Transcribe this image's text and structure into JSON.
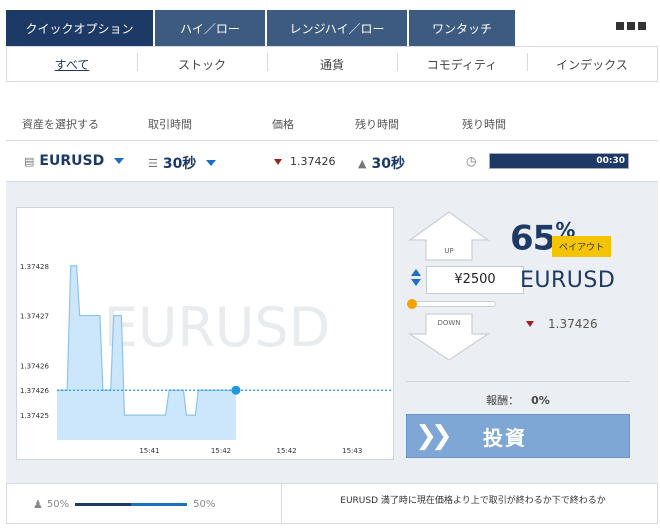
{
  "tabs": [
    {
      "label": "クイックオプション",
      "active": true
    },
    {
      "label": "ハイ／ロー",
      "active": false
    },
    {
      "label": "レンジハイ／ロー",
      "active": false
    },
    {
      "label": "ワンタッチ",
      "active": false
    }
  ],
  "categories": [
    "すべて",
    "ストック",
    "通貨",
    "コモディティ",
    "インデックス"
  ],
  "headers": {
    "asset": "資産を選択する",
    "period": "取引時間",
    "price": "価格",
    "remaining": "残り時間",
    "remaining2": "残り時間"
  },
  "selection": {
    "asset": "EURUSD",
    "period": "30秒",
    "price": "1.37426",
    "remaining": "30秒",
    "timer": "00:30"
  },
  "trade": {
    "up_label": "UP",
    "down_label": "DOWN",
    "amount": "¥2500",
    "payout_percent": "65",
    "payout_percent_sign": "%",
    "payout_badge": "ペイアウト",
    "asset": "EURUSD",
    "price": "1.37426",
    "reward_label": "報酬：",
    "reward_value": "0%",
    "invest_label": "投資"
  },
  "sentiment": {
    "left": "50%",
    "right": "50%",
    "left_fraction": 0.5
  },
  "hint": "EURUSD 満了時に現在価格より上で取引が終わるか下で終わるか",
  "colors": {
    "navy": "#1d3a66",
    "accent": "#1d6fc0",
    "area": "#cce6fb",
    "badge": "#f5c400"
  },
  "chart_data": {
    "type": "area",
    "watermark": "EURUSD",
    "y_ticks": [
      "1.37428",
      "1.37427",
      "1.37426",
      "1.37426",
      "1.37425"
    ],
    "y_tick_values": [
      1.37428,
      1.37427,
      1.37426,
      1.374255,
      1.37425
    ],
    "x_ticks": [
      "15:41",
      "15:42",
      "15:42",
      "15:43"
    ],
    "x_tick_values": [
      15.5,
      27.5,
      38.5,
      49.5
    ],
    "ylim": [
      1.374245,
      1.37429
    ],
    "xlim": [
      0,
      56
    ],
    "strike": 1.374255,
    "points": [
      [
        0,
        1.374255
      ],
      [
        1.7,
        1.374255
      ],
      [
        2.3,
        1.37428
      ],
      [
        3.3,
        1.37428
      ],
      [
        3.8,
        1.37427
      ],
      [
        7.2,
        1.37427
      ],
      [
        7.7,
        1.374255
      ],
      [
        9.0,
        1.374255
      ],
      [
        9.5,
        1.37427
      ],
      [
        10.8,
        1.37427
      ],
      [
        11.3,
        1.37425
      ],
      [
        18.2,
        1.37425
      ],
      [
        18.8,
        1.374255
      ],
      [
        21.2,
        1.374255
      ],
      [
        21.7,
        1.37425
      ],
      [
        23.2,
        1.37425
      ],
      [
        23.7,
        1.374255
      ],
      [
        30.0,
        1.374255
      ]
    ],
    "current": [
      30.0,
      1.374255
    ]
  }
}
